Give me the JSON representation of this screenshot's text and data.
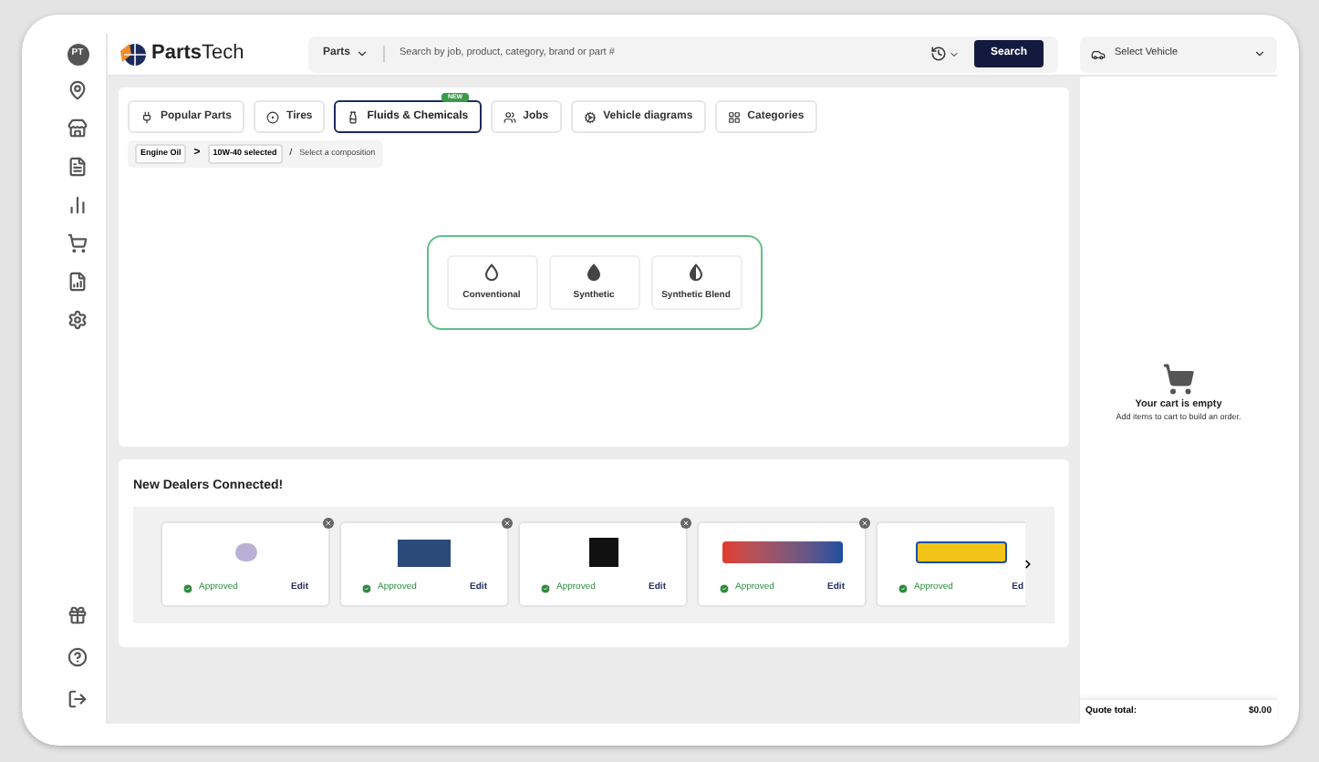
{
  "user": {
    "initials": "PT"
  },
  "brand": {
    "name_bold": "Parts",
    "name_light": "Tech"
  },
  "search": {
    "scope": "Parts",
    "placeholder": "Search by job, product, category, brand or part #",
    "button": "Search"
  },
  "vehicle": {
    "label": "Select Vehicle"
  },
  "sidebar": {
    "items": [
      {
        "kind": "pin"
      },
      {
        "kind": "store"
      },
      {
        "kind": "doc"
      },
      {
        "kind": "chart"
      },
      {
        "kind": "cart"
      },
      {
        "kind": "report"
      },
      {
        "kind": "gear"
      }
    ],
    "bottom": [
      {
        "kind": "gift"
      },
      {
        "kind": "help"
      },
      {
        "kind": "logout"
      }
    ]
  },
  "tabs": [
    {
      "label": "Popular Parts",
      "selected": false
    },
    {
      "label": "Tires",
      "selected": false
    },
    {
      "label": "Fluids & Chemicals",
      "selected": true,
      "badge": "NEW"
    },
    {
      "label": "Jobs",
      "selected": false
    },
    {
      "label": "Vehicle diagrams",
      "selected": false
    },
    {
      "label": "Categories",
      "selected": false
    }
  ],
  "breadcrumb": {
    "items": [
      "Engine Oil",
      "10W-40 selected"
    ],
    "separator": ">",
    "slash": "/",
    "prompt": "Select a composition"
  },
  "compositions": [
    {
      "label": "Conventional",
      "kind": "empty"
    },
    {
      "label": "Synthetic",
      "kind": "full"
    },
    {
      "label": "Synthetic Blend",
      "kind": "half"
    }
  ],
  "dealers": {
    "title": "New Dealers Connected!",
    "cards": [
      {
        "status": "Approved",
        "action": "Edit"
      },
      {
        "status": "Approved",
        "action": "Edit"
      },
      {
        "status": "Approved",
        "action": "Edit"
      },
      {
        "status": "Approved",
        "action": "Edit"
      },
      {
        "status": "Approved",
        "action": "Ed"
      }
    ]
  },
  "cart": {
    "title": "Your cart is empty",
    "subtitle": "Add items to cart to build an order."
  },
  "quote": {
    "label": "Quote total:",
    "value": "$0.00"
  }
}
